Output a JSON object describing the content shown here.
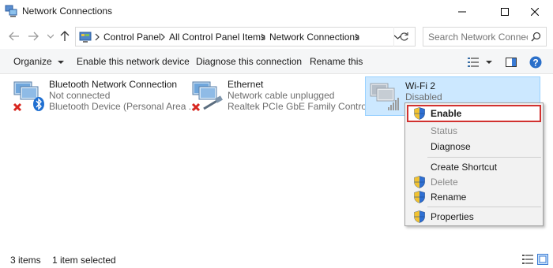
{
  "window": {
    "title": "Network Connections"
  },
  "address": {
    "breadcrumbs": [
      "Control Panel",
      "All Control Panel Items",
      "Network Connections"
    ],
    "search_placeholder": "Search Network Connec..."
  },
  "toolbar": {
    "organize": "Organize",
    "enable": "Enable this network device",
    "diagnose": "Diagnose this connection",
    "rename": "Rename this cc"
  },
  "connections": [
    {
      "name": "Bluetooth Network Connection",
      "status": "Not connected",
      "device": "Bluetooth Device (Personal Area ...",
      "icon": "bluetooth-adapter-icon",
      "disabled_overlay": "red-x-icon"
    },
    {
      "name": "Ethernet",
      "status": "Network cable unplugged",
      "device": "Realtek PCIe GbE Family Controller",
      "icon": "ethernet-adapter-icon",
      "disabled_overlay": "red-x-icon"
    },
    {
      "name": "Wi-Fi 2",
      "status": "Disabled",
      "device": "",
      "icon": "wifi-adapter-icon",
      "selected": true
    }
  ],
  "context_menu": {
    "items": [
      {
        "label": "Enable",
        "icon": "uac-shield-icon",
        "bold": true,
        "highlighted": true
      },
      {
        "label": "Status",
        "disabled": true
      },
      {
        "label": "Diagnose"
      },
      {
        "label": "Create Shortcut"
      },
      {
        "label": "Delete",
        "icon": "uac-shield-icon",
        "disabled": true
      },
      {
        "label": "Rename",
        "icon": "uac-shield-icon"
      },
      {
        "label": "Properties",
        "icon": "uac-shield-icon"
      }
    ]
  },
  "statusbar": {
    "count": "3 items",
    "selection": "1 item selected"
  },
  "colors": {
    "selection_bg": "#cce8ff",
    "selection_border": "#99d1ff",
    "highlight_border": "#d1312f",
    "toolbar_bg": "#f5f6f7",
    "menu_bg": "#f2f2f2"
  }
}
